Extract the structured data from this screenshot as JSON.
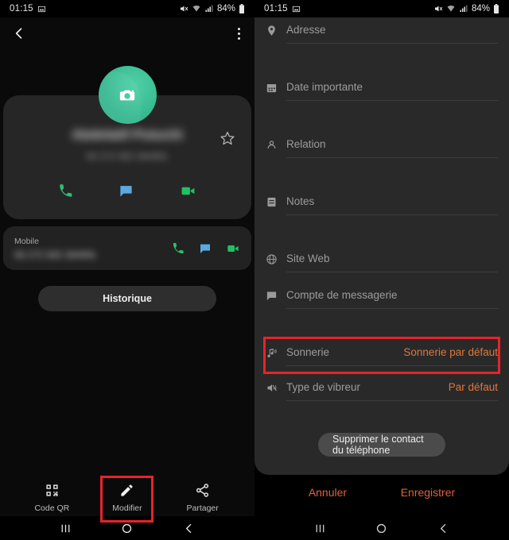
{
  "status_bar": {
    "time": "01:15",
    "battery_text": "84%",
    "icons": [
      "image-icon",
      "mute-icon",
      "wifi-icon",
      "signal-icon",
      "battery-icon"
    ]
  },
  "left_screen": {
    "appbar": {
      "back_icon": "back-arrow-icon",
      "menu_icon": "overflow-menu-icon"
    },
    "avatar": {
      "icon": "camera-icon",
      "color": "#37b990"
    },
    "contact": {
      "name": "Abdelatif Putuchi",
      "number": "06 272 583 384991",
      "favorite_icon": "star-outline-icon"
    },
    "quick_actions": [
      {
        "name": "call",
        "icon": "phone-icon",
        "color": "#2cc06b"
      },
      {
        "name": "message",
        "icon": "message-bubble-icon",
        "color": "#5aa9e0"
      },
      {
        "name": "video",
        "icon": "video-camera-icon",
        "color": "#21c065"
      }
    ],
    "mobile_entry": {
      "label": "Mobile",
      "number": "06 272 583 384991",
      "actions": [
        {
          "name": "call",
          "icon": "phone-icon",
          "color": "#2cc06b"
        },
        {
          "name": "message",
          "icon": "message-bubble-icon",
          "color": "#5aa9e0"
        },
        {
          "name": "video",
          "icon": "video-camera-icon",
          "color": "#21c065"
        }
      ]
    },
    "history_button": "Historique",
    "bottom_actions": [
      {
        "label": "Code QR",
        "icon": "qr-code-icon"
      },
      {
        "label": "Modifier",
        "icon": "pencil-icon"
      },
      {
        "label": "Partager",
        "icon": "share-icon"
      }
    ],
    "highlight": {
      "target": "Modifier",
      "color": "#e8232a"
    },
    "nav_bar": [
      "recents-icon",
      "home-icon",
      "back-icon"
    ]
  },
  "right_screen": {
    "fields": [
      {
        "label": "Adresse",
        "value": "",
        "icon": "location-pin-icon"
      },
      {
        "label": "Date importante",
        "value": "",
        "icon": "calendar-icon"
      },
      {
        "label": "Relation",
        "value": "",
        "icon": "person-relation-icon"
      },
      {
        "label": "Notes",
        "value": "",
        "icon": "notes-icon"
      },
      {
        "label": "Site Web",
        "value": "",
        "icon": "globe-icon"
      },
      {
        "label": "Compte de messagerie",
        "value": "",
        "icon": "chat-bubble-icon"
      },
      {
        "label": "Sonnerie",
        "value": "Sonnerie par défaut",
        "icon": "music-note-icon"
      },
      {
        "label": "Type de vibreur",
        "value": "Par défaut",
        "icon": "vibration-mute-icon"
      }
    ],
    "delete_button": "Supprimer le contact du téléphone",
    "cancel_button": "Annuler",
    "save_button": "Enregistrer",
    "highlight": {
      "target": "Sonnerie",
      "color": "#e8232a"
    },
    "nav_bar": [
      "recents-icon",
      "home-icon",
      "back-icon"
    ]
  }
}
